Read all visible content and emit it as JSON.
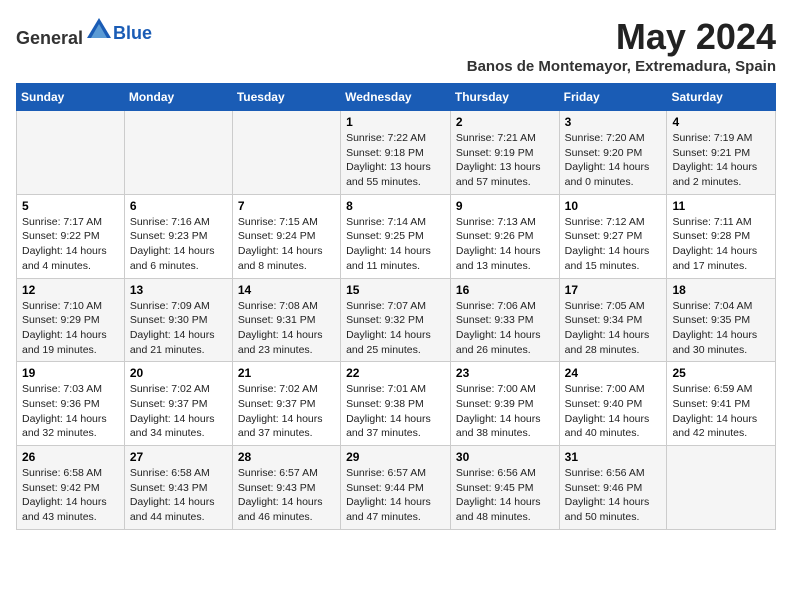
{
  "header": {
    "logo_general": "General",
    "logo_blue": "Blue",
    "month_year": "May 2024",
    "location": "Banos de Montemayor, Extremadura, Spain"
  },
  "weekdays": [
    "Sunday",
    "Monday",
    "Tuesday",
    "Wednesday",
    "Thursday",
    "Friday",
    "Saturday"
  ],
  "weeks": [
    [
      {
        "day": "",
        "info": ""
      },
      {
        "day": "",
        "info": ""
      },
      {
        "day": "",
        "info": ""
      },
      {
        "day": "1",
        "info": "Sunrise: 7:22 AM\nSunset: 9:18 PM\nDaylight: 13 hours\nand 55 minutes."
      },
      {
        "day": "2",
        "info": "Sunrise: 7:21 AM\nSunset: 9:19 PM\nDaylight: 13 hours\nand 57 minutes."
      },
      {
        "day": "3",
        "info": "Sunrise: 7:20 AM\nSunset: 9:20 PM\nDaylight: 14 hours\nand 0 minutes."
      },
      {
        "day": "4",
        "info": "Sunrise: 7:19 AM\nSunset: 9:21 PM\nDaylight: 14 hours\nand 2 minutes."
      }
    ],
    [
      {
        "day": "5",
        "info": "Sunrise: 7:17 AM\nSunset: 9:22 PM\nDaylight: 14 hours\nand 4 minutes."
      },
      {
        "day": "6",
        "info": "Sunrise: 7:16 AM\nSunset: 9:23 PM\nDaylight: 14 hours\nand 6 minutes."
      },
      {
        "day": "7",
        "info": "Sunrise: 7:15 AM\nSunset: 9:24 PM\nDaylight: 14 hours\nand 8 minutes."
      },
      {
        "day": "8",
        "info": "Sunrise: 7:14 AM\nSunset: 9:25 PM\nDaylight: 14 hours\nand 11 minutes."
      },
      {
        "day": "9",
        "info": "Sunrise: 7:13 AM\nSunset: 9:26 PM\nDaylight: 14 hours\nand 13 minutes."
      },
      {
        "day": "10",
        "info": "Sunrise: 7:12 AM\nSunset: 9:27 PM\nDaylight: 14 hours\nand 15 minutes."
      },
      {
        "day": "11",
        "info": "Sunrise: 7:11 AM\nSunset: 9:28 PM\nDaylight: 14 hours\nand 17 minutes."
      }
    ],
    [
      {
        "day": "12",
        "info": "Sunrise: 7:10 AM\nSunset: 9:29 PM\nDaylight: 14 hours\nand 19 minutes."
      },
      {
        "day": "13",
        "info": "Sunrise: 7:09 AM\nSunset: 9:30 PM\nDaylight: 14 hours\nand 21 minutes."
      },
      {
        "day": "14",
        "info": "Sunrise: 7:08 AM\nSunset: 9:31 PM\nDaylight: 14 hours\nand 23 minutes."
      },
      {
        "day": "15",
        "info": "Sunrise: 7:07 AM\nSunset: 9:32 PM\nDaylight: 14 hours\nand 25 minutes."
      },
      {
        "day": "16",
        "info": "Sunrise: 7:06 AM\nSunset: 9:33 PM\nDaylight: 14 hours\nand 26 minutes."
      },
      {
        "day": "17",
        "info": "Sunrise: 7:05 AM\nSunset: 9:34 PM\nDaylight: 14 hours\nand 28 minutes."
      },
      {
        "day": "18",
        "info": "Sunrise: 7:04 AM\nSunset: 9:35 PM\nDaylight: 14 hours\nand 30 minutes."
      }
    ],
    [
      {
        "day": "19",
        "info": "Sunrise: 7:03 AM\nSunset: 9:36 PM\nDaylight: 14 hours\nand 32 minutes."
      },
      {
        "day": "20",
        "info": "Sunrise: 7:02 AM\nSunset: 9:37 PM\nDaylight: 14 hours\nand 34 minutes."
      },
      {
        "day": "21",
        "info": "Sunrise: 7:02 AM\nSunset: 9:37 PM\nDaylight: 14 hours\nand 37 minutes."
      },
      {
        "day": "22",
        "info": "Sunrise: 7:01 AM\nSunset: 9:38 PM\nDaylight: 14 hours\nand 37 minutes."
      },
      {
        "day": "23",
        "info": "Sunrise: 7:00 AM\nSunset: 9:39 PM\nDaylight: 14 hours\nand 38 minutes."
      },
      {
        "day": "24",
        "info": "Sunrise: 7:00 AM\nSunset: 9:40 PM\nDaylight: 14 hours\nand 40 minutes."
      },
      {
        "day": "25",
        "info": "Sunrise: 6:59 AM\nSunset: 9:41 PM\nDaylight: 14 hours\nand 42 minutes."
      }
    ],
    [
      {
        "day": "26",
        "info": "Sunrise: 6:58 AM\nSunset: 9:42 PM\nDaylight: 14 hours\nand 43 minutes."
      },
      {
        "day": "27",
        "info": "Sunrise: 6:58 AM\nSunset: 9:43 PM\nDaylight: 14 hours\nand 44 minutes."
      },
      {
        "day": "28",
        "info": "Sunrise: 6:57 AM\nSunset: 9:43 PM\nDaylight: 14 hours\nand 46 minutes."
      },
      {
        "day": "29",
        "info": "Sunrise: 6:57 AM\nSunset: 9:44 PM\nDaylight: 14 hours\nand 47 minutes."
      },
      {
        "day": "30",
        "info": "Sunrise: 6:56 AM\nSunset: 9:45 PM\nDaylight: 14 hours\nand 48 minutes."
      },
      {
        "day": "31",
        "info": "Sunrise: 6:56 AM\nSunset: 9:46 PM\nDaylight: 14 hours\nand 50 minutes."
      },
      {
        "day": "",
        "info": ""
      }
    ]
  ]
}
